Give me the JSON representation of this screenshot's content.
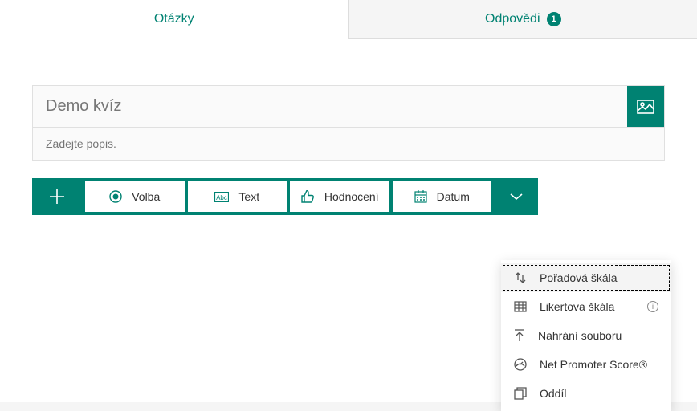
{
  "tabs": {
    "questions": "Otázky",
    "responses": "Odpovědi",
    "responses_count": "1"
  },
  "form": {
    "title": "Demo kvíz",
    "description_placeholder": "Zadejte popis."
  },
  "toolbar": {
    "choice": "Volba",
    "text": "Text",
    "rating": "Hodnocení",
    "date": "Datum"
  },
  "dropdown": {
    "ranking": "Pořadová škála",
    "likert": "Likertova škála",
    "upload": "Nahrání souboru",
    "nps": "Net Promoter Score®",
    "section": "Oddíl"
  }
}
